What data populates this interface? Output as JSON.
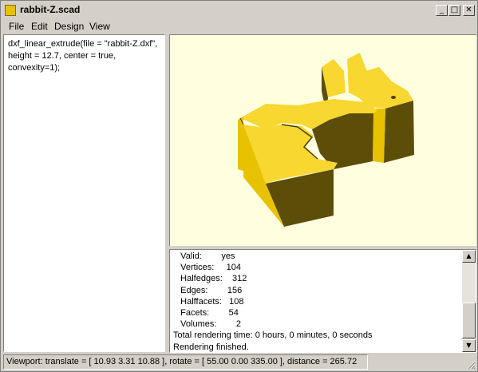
{
  "window": {
    "title": "rabbit-Z.scad",
    "minimize_glyph": "_",
    "maximize_glyph": "□",
    "close_glyph": "✕"
  },
  "menu": {
    "file": "File",
    "edit": "Edit",
    "design": "Design",
    "view": "View"
  },
  "editor": {
    "code": "dxf_linear_extrude(file = \"rabbit-Z.dxf\", height = 12.7, center = true, convexity=1);"
  },
  "console": {
    "lines": [
      "   Valid:        yes",
      "   Vertices:     104",
      "   Halfedges:    312",
      "   Edges:        156",
      "   Halffacets:   108",
      "   Facets:        54",
      "   Volumes:        2",
      "Total rendering time: 0 hours, 0 minutes, 0 seconds",
      "Rendering finished."
    ],
    "scroll_up_glyph": "▲",
    "scroll_down_glyph": "▼"
  },
  "status": {
    "viewport": "Viewport: translate = [ 10.93 3.31 10.88 ], rotate = [ 55.00 0.00 335.00 ], distance = 265.72"
  },
  "colors": {
    "viewport_bg": "#ffffe0",
    "model_light": "#f7d730",
    "model_mid": "#e8c200",
    "model_dark": "#5c4d08",
    "model_shadow": "#4a3d05"
  },
  "icons": {
    "app": "openscad-app-icon"
  }
}
